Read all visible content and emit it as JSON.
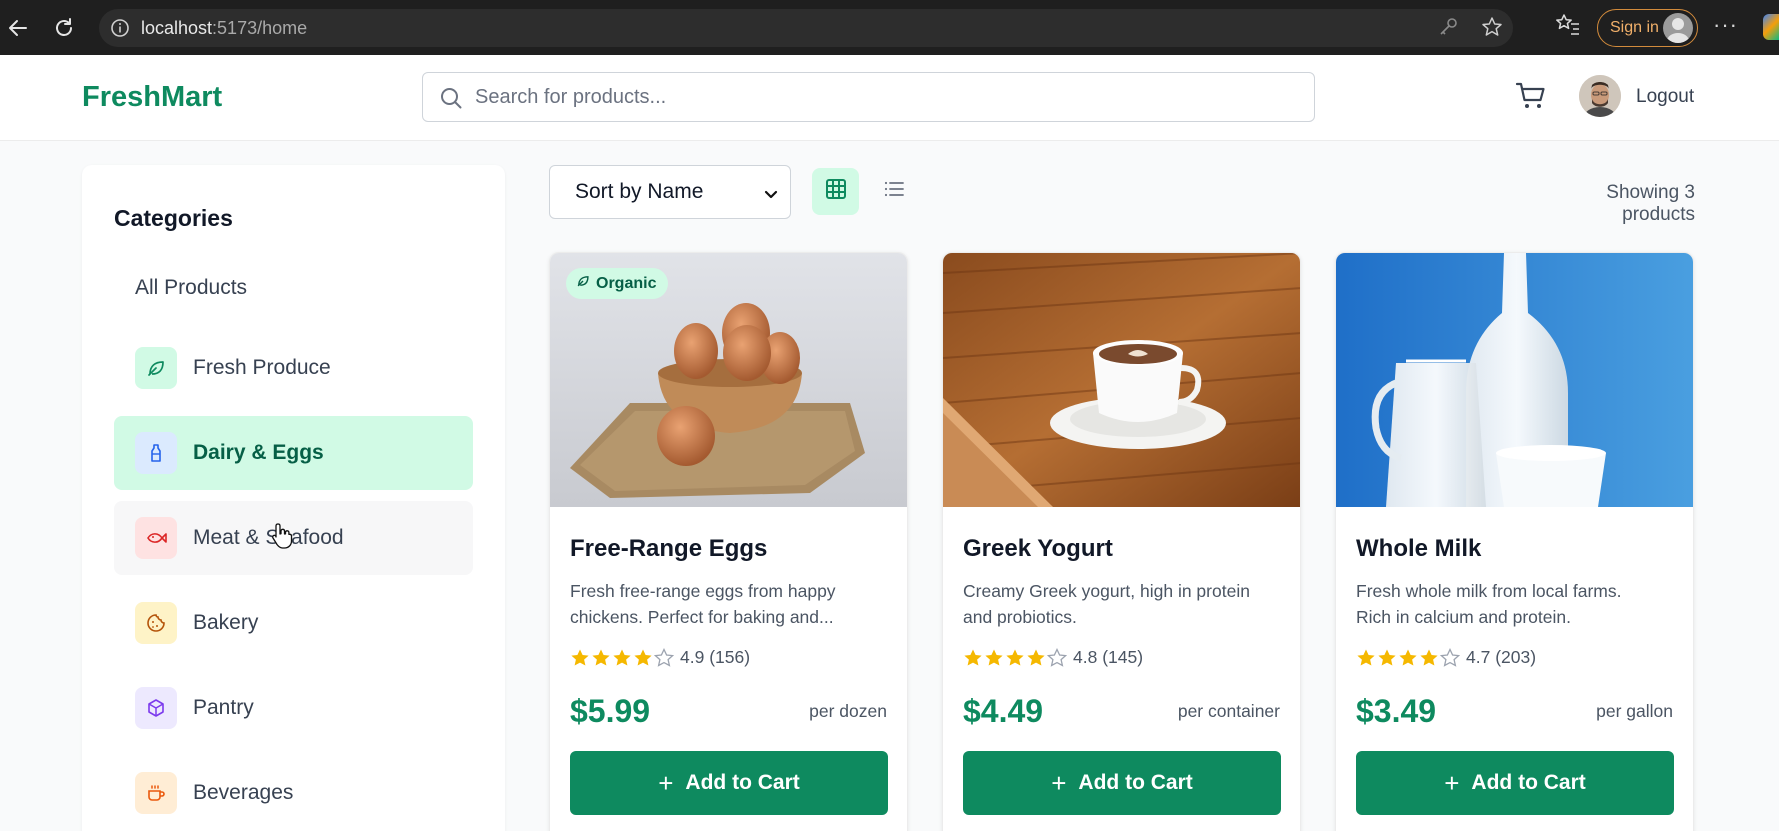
{
  "browser": {
    "url_host": "localhost",
    "url_path": ":5173/home",
    "signin_label": "Sign in",
    "more": "···"
  },
  "header": {
    "logo": "FreshMart",
    "search_placeholder": "Search for products...",
    "logout_label": "Logout"
  },
  "sidebar": {
    "title": "Categories",
    "items": [
      {
        "label": "All Products",
        "icon": "none"
      },
      {
        "label": "Fresh Produce",
        "icon": "leaf-icon",
        "bg": "#d1fae5",
        "fg": "#0e8a5f"
      },
      {
        "label": "Dairy & Eggs",
        "icon": "milk-bottle-icon",
        "bg": "#dbeafe",
        "fg": "#2563eb",
        "active": true
      },
      {
        "label": "Meat & Seafood",
        "icon": "fish-icon",
        "bg": "#fee2e2",
        "fg": "#dc2626"
      },
      {
        "label": "Bakery",
        "icon": "cookie-icon",
        "bg": "#fef3c7",
        "fg": "#b45309"
      },
      {
        "label": "Pantry",
        "icon": "package-icon",
        "bg": "#ede9fe",
        "fg": "#7c3aed"
      },
      {
        "label": "Beverages",
        "icon": "coffee-cup-icon",
        "bg": "#ffedd5",
        "fg": "#ea580c"
      }
    ]
  },
  "toolbar": {
    "sort_label": "Sort by Name",
    "showing_text": "Showing 3 products"
  },
  "products": [
    {
      "name": "Free-Range Eggs",
      "desc_line1": "Fresh free-range eggs from happy",
      "desc_line2": "chickens. Perfect for baking and...",
      "rating_text": "4.9 (156)",
      "stars_filled": 4,
      "price": "$5.99",
      "unit": "per dozen",
      "badge": "Organic",
      "add_label": "Add to Cart"
    },
    {
      "name": "Greek Yogurt",
      "desc_line1": "Creamy Greek yogurt, high in protein",
      "desc_line2": "and probiotics.",
      "rating_text": "4.8 (145)",
      "stars_filled": 4,
      "price": "$4.49",
      "unit": "per container",
      "add_label": "Add to Cart"
    },
    {
      "name": "Whole Milk",
      "desc_line1": "Fresh whole milk from local farms.",
      "desc_line2": "Rich in calcium and protein.",
      "rating_text": "4.7 (203)",
      "stars_filled": 4,
      "price": "$3.49",
      "unit": "per gallon",
      "add_label": "Add to Cart"
    }
  ],
  "colors": {
    "brand": "#0e8a5f",
    "active_bg": "#d1fae5",
    "star": "#f5b800"
  }
}
